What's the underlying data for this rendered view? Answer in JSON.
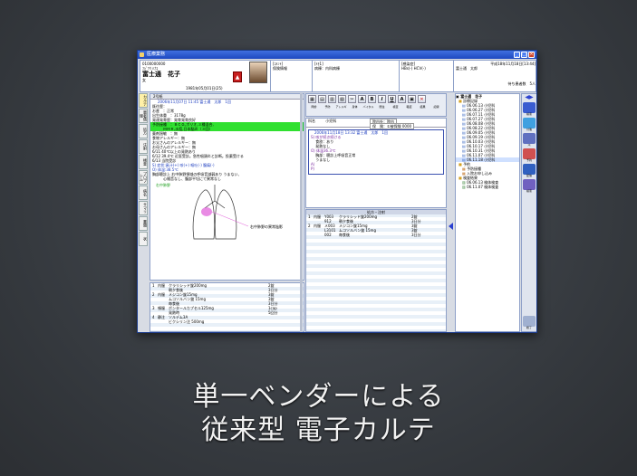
{
  "window": {
    "title": "医療業務"
  },
  "header": {
    "patient_id": "0100000000",
    "patient_kana": "ﾌｼﾞﾂｳ ﾊﾅｺ",
    "patient_name": "富士通　花子",
    "sex_age": "女",
    "birth": "1981年05月01日(25)",
    "memo1": "[ｺﾒﾝﾄ]",
    "memo1_b": "保険情報",
    "memo2": "[ﾒﾓ1]",
    "memo2_b": "病棟：内科病棟",
    "memo3": "[感染症]",
    "memo3_b": "HBs(-) HCV(-)",
    "date": "平成18年11月18日[13:44]",
    "user": "富士通　太郎",
    "counter": "待ち患者数　5人"
  },
  "tabs": [
    "カルテ",
    "患者情報",
    "処方",
    "注射",
    "検査",
    "プロブレム",
    "病名",
    "サマリ",
    "書類",
    "状"
  ],
  "left_pane": {
    "tab_label": "2号紙",
    "entry_title": "2006年11月07日 11:45 富士通　太郎　1回",
    "lines": [
      "既往歴：",
      "お産　：正常",
      "出生体重　：3178g",
      "発達発育歴：発育発育良好",
      "予防接種　：ＢＣＧ,ポリオ,３種混合,",
      "　　　ＭＭＲ,水痘,日本脳炎（３回）",
      "薬剤過敏　：無",
      "食物アレルギー：無",
      "お父さんのアレルギー：無",
      "お母さんのアレルギー：無",
      "6/11 40℃以上の発熱あり",
      "6/12 39.4℃ 近医受診。急性咽頭炎と診断。投薬受ける",
      "6/13 当院受診",
      "S) 症状:鼻汁(+) 咳(+) 嘔吐(-) 腹痛(-)",
      "O) 体温:38.5℃",
      "胸部聴診上 右中肺野領域の呼吸音減弱あり うまない、",
      "　　　心雑音なし、腹部平坦にて異常なし"
    ],
    "diagram_label": "右中肺野",
    "diagram_note": "右中肺野の異常陰影"
  },
  "left_orders": [
    {
      "no": "1",
      "kind": "内服",
      "drug": "クラリシッド錠200mg",
      "qty": "2錠",
      "unit": "分2"
    },
    {
      "no": "",
      "kind": "",
      "drug": "朝夕食後",
      "qty": "3日分",
      "unit": ""
    },
    {
      "no": "2",
      "kind": "内服",
      "drug": "メジコン錠15mg",
      "qty": "3錠",
      "unit": ""
    },
    {
      "no": "",
      "kind": "",
      "drug": "ムコソルバン錠 15mg",
      "qty": "3錠",
      "unit": ""
    },
    {
      "no": "",
      "kind": "",
      "drug": "毎食後",
      "qty": "3日分",
      "unit": ""
    },
    {
      "no": "3",
      "kind": "頓服",
      "drug": "ボンタールカプセル125mg",
      "qty": "1cap",
      "unit": ""
    },
    {
      "no": "",
      "kind": "",
      "drug": "発熱時",
      "qty": "5回分",
      "unit": ""
    },
    {
      "no": "4",
      "kind": "静注",
      "drug": "ソルデム3A",
      "qty": "",
      "unit": ""
    },
    {
      "no": "",
      "kind": "",
      "drug": "ビクシリン注 500mg",
      "qty": "",
      "unit": ""
    }
  ],
  "toolbar": {
    "buttons": [
      {
        "glyph": "▦",
        "label": "ｽﾀﾝﾌﾟ"
      },
      {
        "glyph": "▤",
        "label": "ｼｪｰﾏ"
      },
      {
        "glyph": "▥",
        "label": "定型"
      },
      {
        "glyph": "▧",
        "label": "ｾｯﾄ"
      },
      {
        "glyph": "✂",
        "label": "切取"
      },
      {
        "glyph": "A",
        "label": "文字"
      },
      {
        "glyph": "B",
        "label": "太字"
      },
      {
        "glyph": "I",
        "label": "斜体"
      },
      {
        "glyph": "U",
        "label": "下線"
      },
      {
        "glyph": "A",
        "label": "ｶﾗｰ"
      },
      {
        "glyph": "▣",
        "label": "一時"
      },
      {
        "glyph": "✕",
        "label": "確定"
      }
    ],
    "row2": [
      "問診",
      "予防",
      "アレルギ",
      "身体",
      "バイタル",
      "既往",
      "検査",
      "軽症",
      "結果",
      "記録"
    ]
  },
  "right_pane": {
    "dept_label": "科名",
    "dept": "小児科",
    "visit_label": "院内外：院内",
    "insurance": "保　険：①被保険 0000",
    "entry_title": "2006年11月18日 13:32 富士通　太郎　1回",
    "lines": [
      "S) 咳が続き続ける",
      "　 食欲：あり",
      "　 発熱なし",
      "O) 体温36.3℃",
      "　 胸部：聴診上呼吸音正常",
      "　 うまなし",
      "A)",
      "P)"
    ],
    "rx_header": "処方・注射",
    "rx": [
      {
        "no": "1",
        "kind": "内服",
        "code": "Y003",
        "drug": "クラリシッド錠200mg",
        "qty": "2錠"
      },
      {
        "no": "",
        "kind": "",
        "code": "912",
        "drug": "朝夕食後",
        "qty": "3日分"
      },
      {
        "no": "2",
        "kind": "内服",
        "code": "メ003",
        "drug": "メジコン錠15mg",
        "qty": "3錠"
      },
      {
        "no": "",
        "kind": "",
        "code": "L3101",
        "drug": "ムコソルバン錠 15mg",
        "qty": "3錠"
      },
      {
        "no": "",
        "kind": "",
        "code": "002",
        "drug": "毎食後",
        "qty": "3日分"
      }
    ]
  },
  "tree": {
    "root": "富士通　花子",
    "group1": "診療記録",
    "dates": [
      "06.06.13 小児科",
      "06.06.27 小児科",
      "06.07.11 小児科",
      "06.07.27 小児科",
      "06.08.08 小児科",
      "06.08.22 小児科",
      "06.09.05 小児科",
      "06.09.19 小児科",
      "06.10.03 小児科",
      "06.10.17 小児科",
      "06.10.31 小児科",
      "06.11.07 小児科",
      "06.11.18 小児科"
    ],
    "group2": "予約",
    "group2_items": [
      "予防接種",
      "入院お申し込み"
    ],
    "group3": "検査結果",
    "group3_items": [
      "06.06.13 検体検査",
      "06.11.07 検体検査"
    ]
  },
  "right_tools": [
    "検索",
    "付箋",
    "ﾒﾓ",
    "予約",
    "配信",
    "検索",
    "終了"
  ],
  "caption": {
    "line1": "単一ベンダーによる",
    "line2": "従来型 電子カルテ"
  }
}
